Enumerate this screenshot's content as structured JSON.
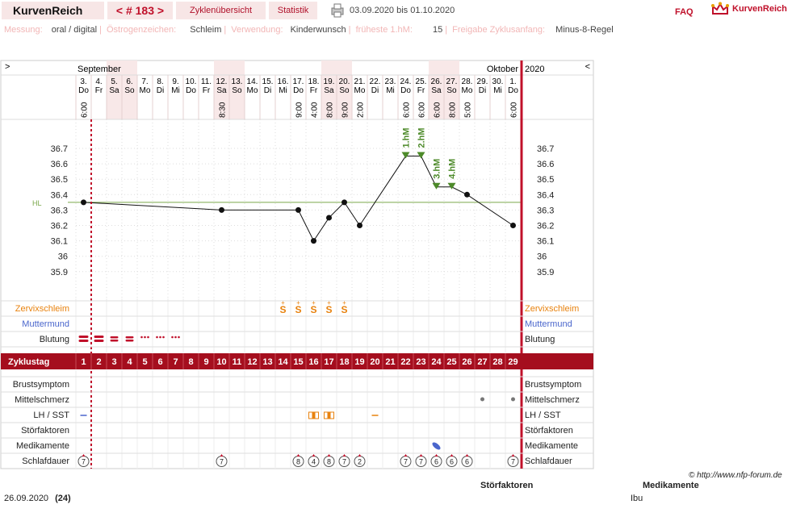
{
  "header": {
    "brand": "KurvenReich",
    "cycle_nav": "< # 183 >",
    "tab_overview": "Zyklenübersicht",
    "tab_stats": "Statistik",
    "date_range": "03.09.2020 bis 01.10.2020",
    "faq": "FAQ",
    "logo_text": "KurvenReich",
    "icon": "printer-icon"
  },
  "meta": {
    "measurement_label": "Messung:",
    "measurement_value": "oral / digital",
    "estrogen_label": "Östrogenzeichen:",
    "estrogen_value": "Schleim",
    "usage_label": "Verwendung:",
    "usage_value": "Kinderwunsch",
    "earliest_label": "früheste 1.hM:",
    "earliest_value": "15",
    "release_label": "Freigabe Zyklusanfang:",
    "release_value": "Minus-8-Regel"
  },
  "chart_data": {
    "type": "line",
    "month_left": "September",
    "month_right": "Oktober",
    "year": "2020",
    "nav_left": ">",
    "nav_right": "<",
    "hl_label": "HL",
    "hl_value": 36.35,
    "ylim": [
      35.8,
      36.8
    ],
    "y_ticks": [
      36.7,
      36.6,
      36.5,
      36.4,
      36.3,
      36.2,
      36.1,
      36,
      35.9
    ],
    "days": [
      {
        "date": "3.",
        "wd": "Do",
        "time": "6:00",
        "cd": "1"
      },
      {
        "date": "4.",
        "wd": "Fr",
        "time": "",
        "cd": "2"
      },
      {
        "date": "5.",
        "wd": "Sa",
        "time": "",
        "cd": "3"
      },
      {
        "date": "6.",
        "wd": "So",
        "time": "",
        "cd": "4"
      },
      {
        "date": "7.",
        "wd": "Mo",
        "time": "",
        "cd": "5"
      },
      {
        "date": "8.",
        "wd": "Di",
        "time": "",
        "cd": "6"
      },
      {
        "date": "9.",
        "wd": "Mi",
        "time": "",
        "cd": "7"
      },
      {
        "date": "10.",
        "wd": "Do",
        "time": "",
        "cd": "8"
      },
      {
        "date": "11.",
        "wd": "Fr",
        "time": "",
        "cd": "9"
      },
      {
        "date": "12.",
        "wd": "Sa",
        "time": "8:30",
        "cd": "10"
      },
      {
        "date": "13.",
        "wd": "So",
        "time": "",
        "cd": "11"
      },
      {
        "date": "14.",
        "wd": "Mo",
        "time": "",
        "cd": "12"
      },
      {
        "date": "15.",
        "wd": "Di",
        "time": "",
        "cd": "13"
      },
      {
        "date": "16.",
        "wd": "Mi",
        "time": "",
        "cd": "14"
      },
      {
        "date": "17.",
        "wd": "Do",
        "time": "9:00",
        "cd": "15"
      },
      {
        "date": "18.",
        "wd": "Fr",
        "time": "4:00",
        "cd": "16"
      },
      {
        "date": "19.",
        "wd": "Sa",
        "time": "8:00",
        "cd": "17"
      },
      {
        "date": "20.",
        "wd": "So",
        "time": "9:00",
        "cd": "18"
      },
      {
        "date": "21.",
        "wd": "Mo",
        "time": "2:00",
        "cd": "19"
      },
      {
        "date": "22.",
        "wd": "Di",
        "time": "",
        "cd": "20"
      },
      {
        "date": "23.",
        "wd": "Mi",
        "time": "",
        "cd": "21"
      },
      {
        "date": "24.",
        "wd": "Do",
        "time": "6:00",
        "cd": "22"
      },
      {
        "date": "25.",
        "wd": "Fr",
        "time": "6:00",
        "cd": "23"
      },
      {
        "date": "26.",
        "wd": "Sa",
        "time": "6:00",
        "cd": "24"
      },
      {
        "date": "27.",
        "wd": "So",
        "time": "8:00",
        "cd": "25"
      },
      {
        "date": "28.",
        "wd": "Mo",
        "time": "5:00",
        "cd": "26"
      },
      {
        "date": "29.",
        "wd": "Di",
        "time": "",
        "cd": "27"
      },
      {
        "date": "30.",
        "wd": "Mi",
        "time": "",
        "cd": "28"
      },
      {
        "date": "1.",
        "wd": "Do",
        "time": "6:00",
        "cd": "29"
      }
    ],
    "weekend_days": [
      3,
      4,
      10,
      11,
      17,
      18,
      24,
      25
    ],
    "temperatures": [
      {
        "cd": 1,
        "t": 36.35
      },
      {
        "cd": 10,
        "t": 36.3
      },
      {
        "cd": 15,
        "t": 36.3
      },
      {
        "cd": 16,
        "t": 36.1
      },
      {
        "cd": 17,
        "t": 36.25
      },
      {
        "cd": 18,
        "t": 36.35
      },
      {
        "cd": 19,
        "t": 36.2
      },
      {
        "cd": 22,
        "t": 36.65
      },
      {
        "cd": 23,
        "t": 36.65
      },
      {
        "cd": 24,
        "t": 36.45
      },
      {
        "cd": 25,
        "t": 36.45
      },
      {
        "cd": 26,
        "t": 36.4
      },
      {
        "cd": 29,
        "t": 36.2
      }
    ],
    "hm_markers": [
      {
        "cd": 22,
        "label": "1.hM"
      },
      {
        "cd": 23,
        "label": "2.hM"
      },
      {
        "cd": 24,
        "label": "3.hM"
      },
      {
        "cd": 25,
        "label": "4.hM"
      }
    ],
    "rows_top": [
      "Zervixschleim",
      "Muttermund",
      "Blutung"
    ],
    "row_cycle_label": "Zyklustag",
    "rows_bottom": [
      "Brustsymptom",
      "Mittelschmerz",
      "LH / SST",
      "Störfaktoren",
      "Medikamente",
      "Schlafdauer"
    ],
    "mucus_days": [
      14,
      15,
      16,
      17,
      18
    ],
    "mucus_symbol": "S",
    "bleeding": [
      {
        "cd": 1,
        "level": "heavy"
      },
      {
        "cd": 2,
        "level": "heavy"
      },
      {
        "cd": 3,
        "level": "medium"
      },
      {
        "cd": 4,
        "level": "medium"
      },
      {
        "cd": 5,
        "level": "light"
      },
      {
        "cd": 6,
        "level": "light"
      },
      {
        "cd": 7,
        "level": "light"
      }
    ],
    "mittelschmerz_days": [
      27,
      29
    ],
    "lh_days": [
      {
        "cd": 1,
        "kind": "neg"
      },
      {
        "cd": 16,
        "kind": "test"
      },
      {
        "cd": 17,
        "kind": "test"
      },
      {
        "cd": 20,
        "kind": "neg"
      }
    ],
    "medication_days": [
      24
    ],
    "sleep": [
      {
        "cd": 1,
        "h": "7"
      },
      {
        "cd": 10,
        "h": "7"
      },
      {
        "cd": 15,
        "h": "8"
      },
      {
        "cd": 16,
        "h": "4"
      },
      {
        "cd": 17,
        "h": "8"
      },
      {
        "cd": 18,
        "h": "7"
      },
      {
        "cd": 19,
        "h": "2"
      },
      {
        "cd": 22,
        "h": "7"
      },
      {
        "cd": 23,
        "h": "7"
      },
      {
        "cd": 24,
        "h": "6"
      },
      {
        "cd": 25,
        "h": "6"
      },
      {
        "cd": 26,
        "h": "6"
      },
      {
        "cd": 29,
        "h": "7"
      }
    ],
    "colors": {
      "accent": "#c0102a",
      "cycle_band": "#a50e1e",
      "weekend": "#f8e8e8",
      "cervix": "#e8820e",
      "muttermund": "#4a66cc",
      "hm": "#4d8a2a",
      "hl_line": "#7aa84a"
    }
  },
  "footer": {
    "date": "26.09.2020",
    "count": "(24)",
    "credit": "© http://www.nfp-forum.de",
    "col_disturb": "Störfaktoren",
    "col_med": "Medikamente",
    "med_value": "Ibu"
  }
}
